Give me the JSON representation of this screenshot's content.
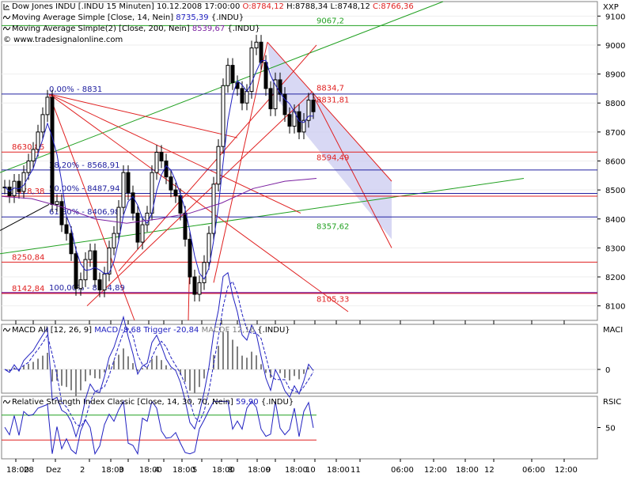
{
  "header": {
    "main_line": {
      "name": "Dow Jones INDU [.INDU  15 Minuten]",
      "date": "10.12.2008 17:00:00",
      "o": "O:8784,12",
      "h": "H:8788,34",
      "l": "L:8748,12",
      "c": "C:8766,36"
    },
    "ma14": {
      "name": "Moving Average Simple [Close, 14, Nein]",
      "value": "8735,39",
      "sym": "{.INDU}"
    },
    "ma200": {
      "name": "Moving Average Simple(2) [Close, 200, Nein]",
      "value": "8539,67",
      "sym": "{.INDU}"
    },
    "copyright": "© www.tradesignalonline.com"
  },
  "axis_names": {
    "main": "XXP",
    "macd": "MACI",
    "rsi": "RSIC"
  },
  "macd_header": {
    "name": "MACD All [12, 26, 9]",
    "macd": "MACD -8,68",
    "trigger": "Trigger -20,84",
    "macdf": "MACDF 12,16",
    "sym": "{.INDU}"
  },
  "rsi_header": {
    "name": "Relative Strength Index Classic [Close, 14, 30, 70, Nein]",
    "value": "59,90",
    "sym": "{.INDU}"
  },
  "colors": {
    "price": "#000000",
    "ma14": "#2020c0",
    "ma200": "#7a1fa0",
    "green": "#20a020",
    "red": "#e02020",
    "blue": "#2020a0",
    "channel": "#c8c8f0"
  },
  "chart_data": [
    {
      "type": "candlestick",
      "panel": "price",
      "ylim": [
        8050,
        9150
      ],
      "yticks": [
        8100,
        8200,
        8300,
        8400,
        8500,
        8600,
        8700,
        8800,
        8900,
        9000,
        9100
      ],
      "ytick_labels": [
        "8100",
        "8200",
        "8300",
        "8400",
        "8500",
        "8600",
        "8700",
        "8800",
        "8900",
        "9000",
        "9100"
      ],
      "xticks": [
        "18:00",
        "28",
        "Dez",
        "2",
        "18:00",
        "3",
        "18:00",
        "4",
        "18:00",
        "5",
        "18:00",
        "8",
        "18:00",
        "9",
        "18:00",
        "10",
        "18:00",
        "11",
        "06:00",
        "12:00",
        "18:00",
        "12",
        "06:00",
        "12:00"
      ],
      "close_path": [
        8510,
        8480,
        8530,
        8495,
        8560,
        8600,
        8640,
        8700,
        8760,
        8820,
        8450,
        8460,
        8380,
        8350,
        8280,
        8160,
        8190,
        8260,
        8290,
        8190,
        8155,
        8210,
        8300,
        8350,
        8440,
        8560,
        8490,
        8420,
        8320,
        8380,
        8420,
        8560,
        8630,
        8600,
        8545,
        8500,
        8480,
        8420,
        8330,
        8200,
        8140,
        8180,
        8250,
        8350,
        8520,
        8650,
        8860,
        8930,
        8870,
        8850,
        8800,
        8840,
        8990,
        9010,
        8940,
        8850,
        8780,
        8880,
        8830,
        8760,
        8720,
        8770,
        8700,
        8740,
        8810,
        8770
      ],
      "levels": [
        {
          "label": "0,00% - 8831",
          "value": 8831,
          "color": "#2020a0"
        },
        {
          "label": "38,20% - 8568,91",
          "value": 8568.91,
          "color": "#2020a0"
        },
        {
          "label": "50,00% - 8487,94",
          "value": 8487.94,
          "color": "#2020a0"
        },
        {
          "label": "61,80% - 8406,98",
          "value": 8406.98,
          "color": "#2020a0"
        },
        {
          "label": "100,00% - 8144,89",
          "value": 8144.89,
          "color": "#2020a0"
        },
        {
          "label": "8630,85",
          "value": 8630.85,
          "color": "#e02020"
        },
        {
          "label": "8478,38",
          "value": 8478.38,
          "color": "#e02020"
        },
        {
          "label": "8250,84",
          "value": 8250.84,
          "color": "#e02020"
        },
        {
          "label": "8142,84",
          "value": 8142.84,
          "color": "#e02020"
        },
        {
          "label": "9067,2",
          "value": 9067.2,
          "color": "#20a020"
        },
        {
          "label": "8357,62",
          "value": 8357.62,
          "color": "#20a020"
        },
        {
          "label": "8834,7",
          "value": 8834.7,
          "color": "#e02020"
        },
        {
          "label": "8831,81",
          "value": 8831.81,
          "color": "#e02020"
        },
        {
          "label": "8594,49",
          "value": 8594.49,
          "color": "#e02020"
        },
        {
          "label": "8105,33",
          "value": 8105.33,
          "color": "#e02020"
        }
      ]
    },
    {
      "type": "line",
      "panel": "macd",
      "yticks": [
        0
      ],
      "ytick_labels": [
        "0"
      ],
      "series": [
        {
          "name": "MACD",
          "last": -8.68
        },
        {
          "name": "Trigger",
          "last": -20.84
        },
        {
          "name": "MACDF",
          "last": 12.16
        }
      ]
    },
    {
      "type": "line",
      "panel": "rsi",
      "yticks": [
        50
      ],
      "ytick_labels": [
        "50"
      ],
      "levels": [
        30,
        70
      ],
      "series": [
        {
          "name": "RSI",
          "last": 59.9
        }
      ]
    }
  ]
}
